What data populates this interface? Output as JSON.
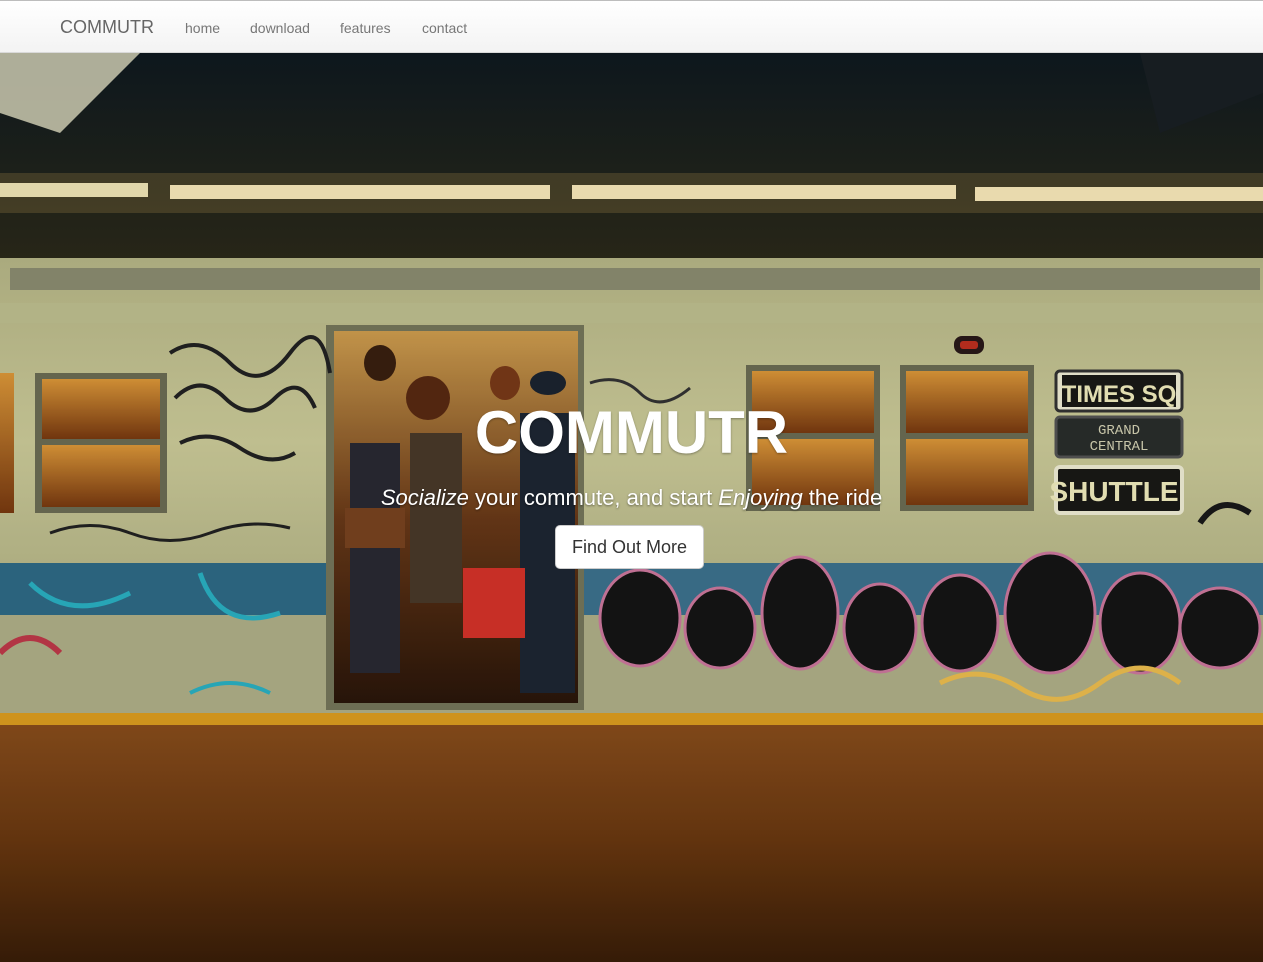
{
  "nav": {
    "brand": "COMMUTR",
    "items": [
      {
        "label": "home"
      },
      {
        "label": "download"
      },
      {
        "label": "features"
      },
      {
        "label": "contact"
      }
    ]
  },
  "hero": {
    "title": "COMMUTR",
    "subtitle": {
      "part1": "Socialize",
      "part2": " your commute, and start ",
      "part3": "Enjoying",
      "part4": " the ride"
    },
    "cta_label": "Find Out More",
    "signs": {
      "sign1": "TIMES SQ",
      "sign2_line1": "GRAND",
      "sign2_line2": "CENTRAL",
      "sign3": "SHUTTLE"
    }
  },
  "colors": {
    "nav_bg": "#f8f8f8",
    "brand_text": "#666666",
    "nav_text": "#777777",
    "hero_text": "#ffffff",
    "button_bg": "#ffffff"
  }
}
